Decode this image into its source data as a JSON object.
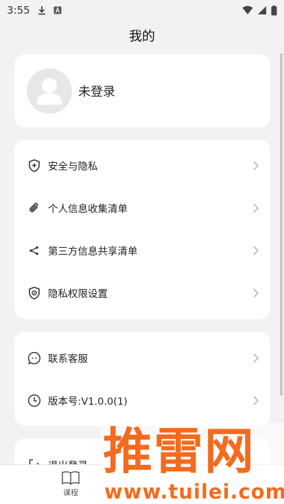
{
  "status_bar": {
    "time": "3:55",
    "icons": [
      "download-icon",
      "a-notification-icon",
      "wifi-icon",
      "cell-signal-icon",
      "battery-icon"
    ]
  },
  "header": {
    "title": "我的"
  },
  "profile": {
    "login_text": "未登录"
  },
  "menu_group_1": [
    {
      "label": "安全与隐私",
      "icon": "shield-plus-icon"
    },
    {
      "label": "个人信息收集清单",
      "icon": "paperclip-icon"
    },
    {
      "label": "第三方信息共享清单",
      "icon": "share-icon"
    },
    {
      "label": "隐私权限设置",
      "icon": "shield-settings-icon"
    }
  ],
  "menu_group_2": [
    {
      "label": "联系客服",
      "icon": "chat-bubble-icon"
    },
    {
      "label": "版本号:V1.0.0(1)",
      "icon": "clock-icon"
    }
  ],
  "menu_group_3": [
    {
      "label": "退出登录",
      "icon": "logout-icon"
    }
  ],
  "tab_bar": {
    "tabs": [
      {
        "label": "课程",
        "icon": "book-icon"
      }
    ]
  },
  "watermark": {
    "title": "推雷网",
    "url": "www.tuilei.com"
  },
  "colors": {
    "background": "#f2f2f4",
    "card": "#ffffff",
    "watermark": "#f46a1e"
  }
}
